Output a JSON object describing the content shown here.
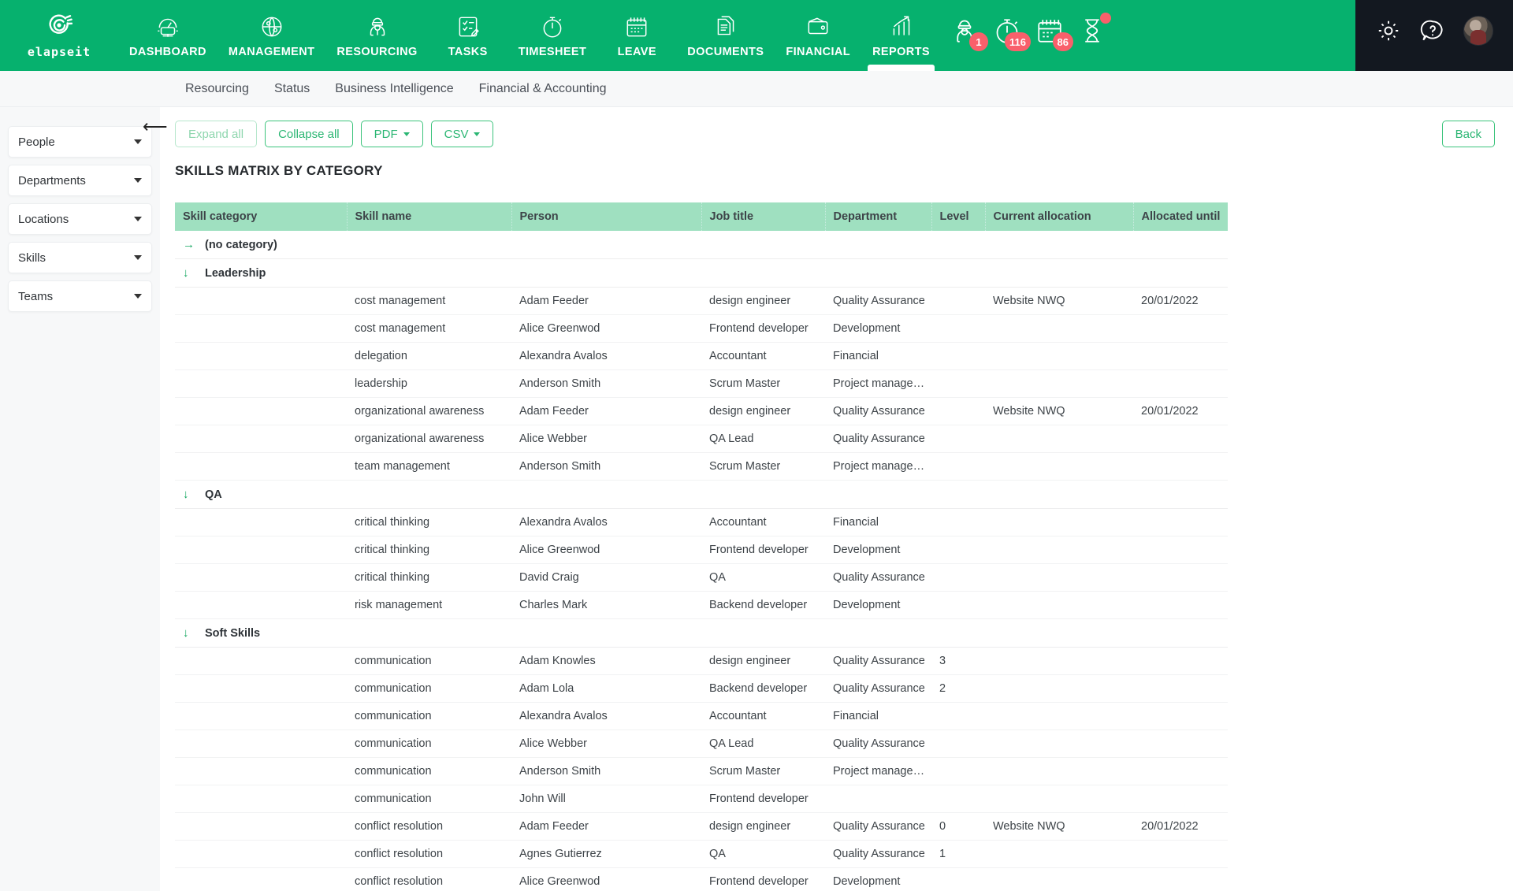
{
  "brand": {
    "name": "elapseit",
    "icon": "elapseit-logo-icon"
  },
  "topnav": {
    "items": [
      {
        "label": "DASHBOARD",
        "icon": "dashboard-gauge-icon",
        "active": false
      },
      {
        "label": "MANAGEMENT",
        "icon": "globe-people-icon",
        "active": false
      },
      {
        "label": "RESOURCING",
        "icon": "worker-icon",
        "active": false
      },
      {
        "label": "TASKS",
        "icon": "checklist-pencil-icon",
        "active": false
      },
      {
        "label": "TIMESHEET",
        "icon": "stopwatch-icon",
        "active": false
      },
      {
        "label": "LEAVE",
        "icon": "calendar-icon",
        "active": false
      },
      {
        "label": "DOCUMENTS",
        "icon": "documents-icon",
        "active": false
      },
      {
        "label": "FINANCIAL",
        "icon": "wallet-icon",
        "active": false
      },
      {
        "label": "REPORTS",
        "icon": "bar-chart-arrow-icon",
        "active": true
      }
    ],
    "alerts": [
      {
        "icon": "worker-alert-icon",
        "badge": "1"
      },
      {
        "icon": "stopwatch-alert-icon",
        "badge": "116"
      },
      {
        "icon": "calendar-alert-icon",
        "badge": "86"
      },
      {
        "icon": "hourglass-alert-icon",
        "badge": ""
      }
    ],
    "right": [
      {
        "icon": "gear-icon"
      },
      {
        "icon": "help-question-icon"
      },
      {
        "icon": "avatar"
      }
    ]
  },
  "subnav": {
    "items": [
      "Resourcing",
      "Status",
      "Business Intelligence",
      "Financial & Accounting"
    ]
  },
  "sidebar": {
    "filters": [
      "People",
      "Departments",
      "Locations",
      "Skills",
      "Teams"
    ]
  },
  "toolbar": {
    "expand_all": "Expand all",
    "collapse_all": "Collapse all",
    "pdf": "PDF",
    "csv": "CSV",
    "back": "Back",
    "collapse_panel_icon": "arrow-left-icon"
  },
  "page_title": "SKILLS MATRIX BY CATEGORY",
  "table": {
    "columns": [
      "Skill category",
      "Skill name",
      "Person",
      "Job title",
      "Department",
      "Level",
      "Current allocation",
      "Allocated until"
    ],
    "groups": [
      {
        "name": "(no category)",
        "expanded": false,
        "icon": "arrow-right-icon",
        "rows": []
      },
      {
        "name": "Leadership",
        "expanded": true,
        "icon": "arrow-down-icon",
        "rows": [
          [
            "",
            "cost management",
            "Adam Feeder",
            "design engineer",
            "Quality Assurance",
            "",
            "Website NWQ",
            "20/01/2022"
          ],
          [
            "",
            "cost management",
            "Alice Greenwod",
            "Frontend developer",
            "Development",
            "",
            "",
            ""
          ],
          [
            "",
            "delegation",
            "Alexandra Avalos",
            "Accountant",
            "Financial",
            "",
            "",
            ""
          ],
          [
            "",
            "leadership",
            "Anderson Smith",
            "Scrum Master",
            "Project management",
            "",
            "",
            ""
          ],
          [
            "",
            "organizational awareness",
            "Adam Feeder",
            "design engineer",
            "Quality Assurance",
            "",
            "Website NWQ",
            "20/01/2022"
          ],
          [
            "",
            "organizational awareness",
            "Alice Webber",
            "QA Lead",
            "Quality Assurance",
            "",
            "",
            ""
          ],
          [
            "",
            "team management",
            "Anderson Smith",
            "Scrum Master",
            "Project management",
            "",
            "",
            ""
          ]
        ]
      },
      {
        "name": "QA",
        "expanded": true,
        "icon": "arrow-down-icon",
        "rows": [
          [
            "",
            "critical thinking",
            "Alexandra Avalos",
            "Accountant",
            "Financial",
            "",
            "",
            ""
          ],
          [
            "",
            "critical thinking",
            "Alice Greenwod",
            "Frontend developer",
            "Development",
            "",
            "",
            ""
          ],
          [
            "",
            "critical thinking",
            "David Craig",
            "QA",
            "Quality Assurance",
            "",
            "",
            ""
          ],
          [
            "",
            "risk management",
            "Charles Mark",
            "Backend developer",
            "Development",
            "",
            "",
            ""
          ]
        ]
      },
      {
        "name": "Soft Skills",
        "expanded": true,
        "icon": "arrow-down-icon",
        "rows": [
          [
            "",
            "communication",
            "Adam Knowles",
            "design engineer",
            "Quality Assurance",
            "3",
            "",
            ""
          ],
          [
            "",
            "communication",
            "Adam Lola",
            "Backend developer",
            "Quality Assurance",
            "2",
            "",
            ""
          ],
          [
            "",
            "communication",
            "Alexandra Avalos",
            "Accountant",
            "Financial",
            "",
            "",
            ""
          ],
          [
            "",
            "communication",
            "Alice Webber",
            "QA Lead",
            "Quality Assurance",
            "",
            "",
            ""
          ],
          [
            "",
            "communication",
            "Anderson Smith",
            "Scrum Master",
            "Project management",
            "",
            "",
            ""
          ],
          [
            "",
            "communication",
            "John Will",
            "Frontend developer",
            "",
            "",
            "",
            ""
          ],
          [
            "",
            "conflict resolution",
            "Adam Feeder",
            "design engineer",
            "Quality Assurance",
            "0",
            "Website NWQ",
            "20/01/2022"
          ],
          [
            "",
            "conflict resolution",
            "Agnes Gutierrez",
            "QA",
            "Quality Assurance",
            "1",
            "",
            ""
          ],
          [
            "",
            "conflict resolution",
            "Alice Greenwod",
            "Frontend developer",
            "Development",
            "",
            "",
            ""
          ]
        ]
      }
    ]
  },
  "colors": {
    "brand_green": "#06b16e",
    "accent_green": "#2bb673",
    "header_green": "#9fe0c0",
    "badge_red": "#f9606b",
    "dark_panel": "#131820"
  }
}
